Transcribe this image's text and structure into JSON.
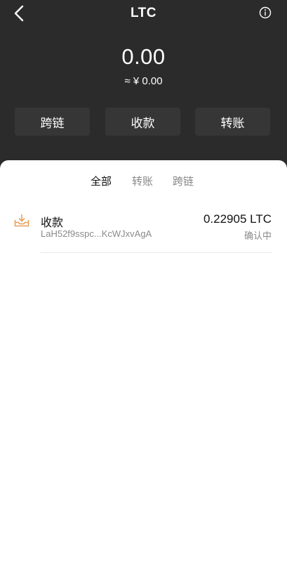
{
  "header": {
    "title": "LTC",
    "back_icon": "chevron-left-icon",
    "info_icon": "info-circle-icon"
  },
  "balance": {
    "amount": "0.00",
    "fiat": "≈ ¥ 0.00"
  },
  "actions": [
    {
      "label": "跨链"
    },
    {
      "label": "收款"
    },
    {
      "label": "转账"
    }
  ],
  "tabs": [
    {
      "label": "全部",
      "active": true
    },
    {
      "label": "转账",
      "active": false
    },
    {
      "label": "跨链",
      "active": false
    }
  ],
  "transactions": [
    {
      "icon": "receive-tray-icon",
      "type": "收款",
      "address": "LaH52f9sspc...KcWJxvAgA",
      "amount": "0.22905 LTC",
      "status": "确认中"
    }
  ],
  "colors": {
    "header_bg": "#2b2b2b",
    "action_bg": "#363636",
    "receive_icon": "#e8a05c"
  }
}
